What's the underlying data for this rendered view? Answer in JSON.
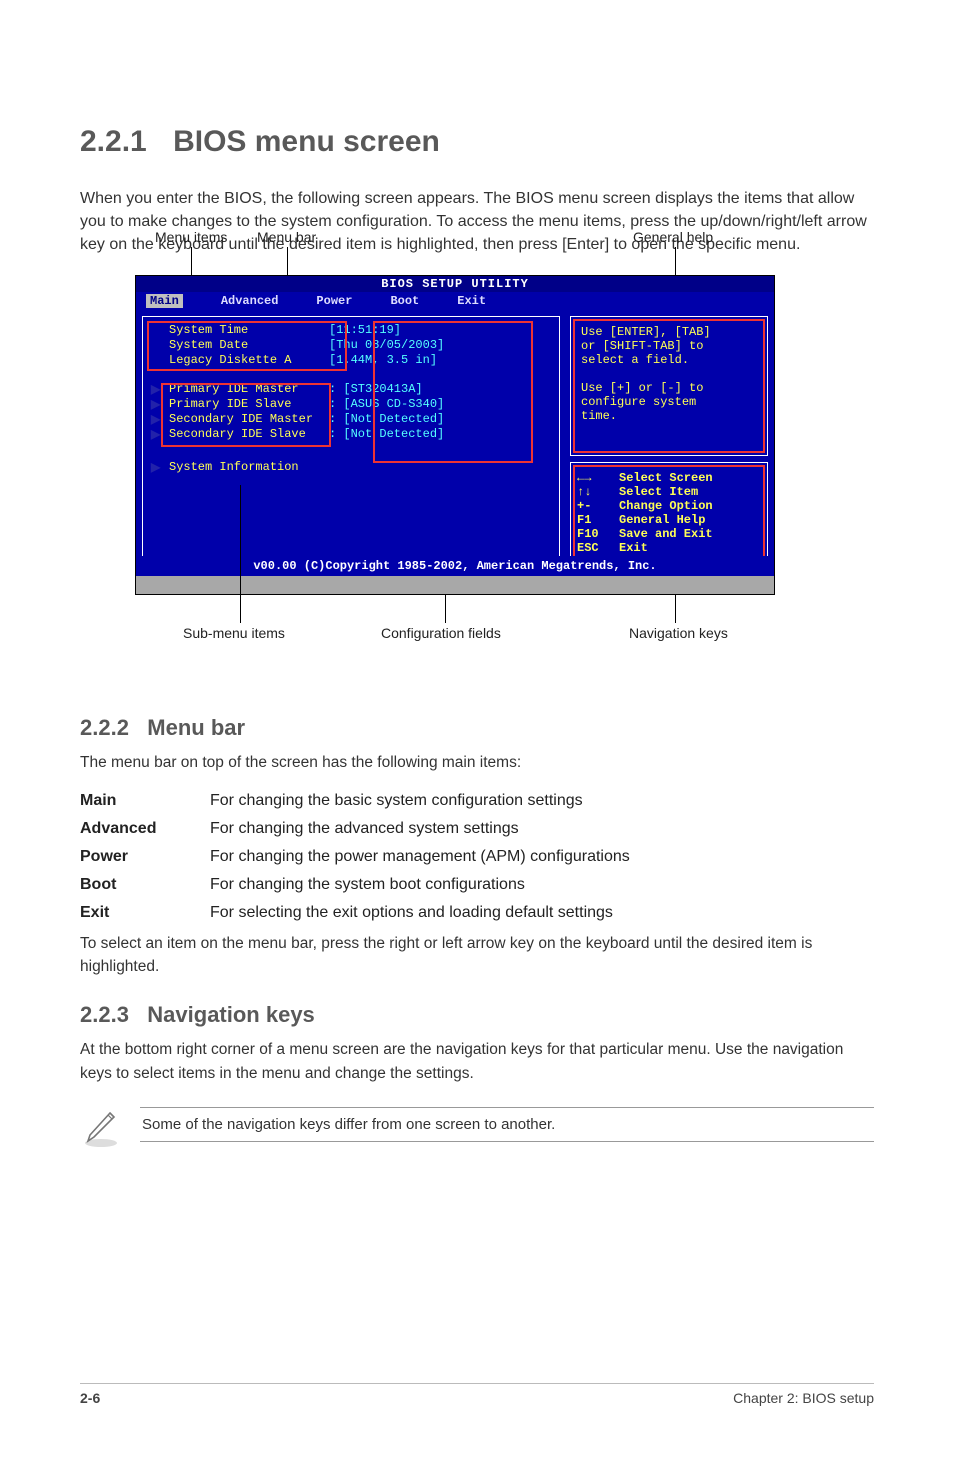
{
  "section": {
    "number": "2.2.1",
    "title": "BIOS menu screen"
  },
  "intro": "When you enter the BIOS, the following screen appears. The BIOS menu screen displays the items that allow you to make changes to the system configuration. To access the menu items, press the up/down/right/left arrow key on the keyboard until the desired item is highlighted, then press [Enter] to open the specific menu.",
  "bios": {
    "title": "BIOS SETUP UTILITY",
    "menus": [
      "Main",
      "Advanced",
      "Power",
      "Boot",
      "Exit"
    ],
    "selected_menu": 0,
    "left": {
      "plain": [
        {
          "label": "System Time",
          "value": "[11:51:19]"
        },
        {
          "label": "System Date",
          "value": "[Thu 08/05/2003]"
        },
        {
          "label": "Legacy Diskette A",
          "value": "[1.44M, 3.5 in]"
        }
      ],
      "submenu": [
        {
          "label": "Primary IDE Master",
          "value": ": [ST320413A]"
        },
        {
          "label": "Primary IDE Slave",
          "value": ": [ASUS CD-S340]"
        },
        {
          "label": "Secondary IDE Master",
          "value": ": [Not Detected]"
        },
        {
          "label": "Secondary IDE Slave",
          "value": ": [Not Detected]"
        }
      ],
      "tail": [
        {
          "label": "System Information",
          "value": ""
        }
      ]
    },
    "help": "Use [ENTER], [TAB]\nor [SHIFT-TAB] to\nselect a field.\n\nUse [+] or [-] to\nconfigure system\ntime.",
    "keys": [
      {
        "k": "←→",
        "d": "Select Screen"
      },
      {
        "k": "↑↓",
        "d": "Select Item"
      },
      {
        "k": "+-",
        "d": "Change Option"
      },
      {
        "k": "F1",
        "d": "General Help"
      },
      {
        "k": "F10",
        "d": "Save and Exit"
      },
      {
        "k": "ESC",
        "d": "Exit"
      }
    ],
    "footer": "v00.00 (C)Copyright 1985-2002, American Megatrends, Inc."
  },
  "callouts": {
    "top_left": [
      "Menu items",
      "Menu bar"
    ],
    "top_right": "General help",
    "bottom_left": "Sub-menu items",
    "bottom_center": "Configuration fields",
    "bottom_right": "Navigation keys"
  },
  "subsection": {
    "number": "2.2.2",
    "title": "Menu bar",
    "body": "The menu bar on top of the screen has the following main items:"
  },
  "menubar_table": [
    {
      "k": "Main",
      "d": "For changing the basic system configuration settings"
    },
    {
      "k": "Advanced",
      "d": "For changing the advanced system settings"
    },
    {
      "k": "Power",
      "d": "For changing the power management (APM) configurations"
    },
    {
      "k": "Boot",
      "d": "For changing the system boot configurations"
    },
    {
      "k": "Exit",
      "d": "For selecting the exit options and loading default settings"
    }
  ],
  "menubar_tail": "To select an item on the menu bar, press the right or left arrow key on the keyboard until the desired item is highlighted.",
  "subsection2": {
    "number": "2.2.3",
    "title": "Navigation keys",
    "body": "At the bottom right corner of a menu screen are the navigation keys for that particular menu. Use the navigation keys to select items in the menu and change the settings."
  },
  "note": "Some of the navigation keys differ from one screen to another.",
  "footer": {
    "left": "2-6",
    "right": "Chapter 2: BIOS setup"
  }
}
